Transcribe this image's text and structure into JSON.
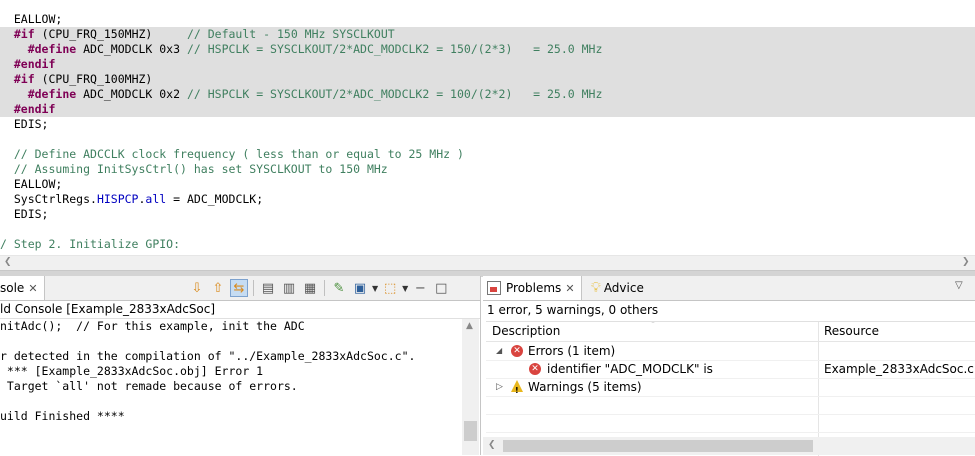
{
  "editor": {
    "lines": [
      {
        "pre": "  EALLOW;",
        "pp": "",
        "mid": "",
        "cmt": "",
        "shaded": false
      },
      {
        "pre": "  ",
        "pp": "#if",
        "mid": " (CPU_FRQ_150MHZ)     ",
        "cmt": "// Default - 150 MHz SYSCLKOUT",
        "shaded": true
      },
      {
        "pre": "    ",
        "pp": "#define",
        "mid": " ADC_MODCLK 0x3 ",
        "cmt": "// HSPCLK = SYSCLKOUT/2*ADC_MODCLK2 = 150/(2*3)   = 25.0 MHz",
        "shaded": true
      },
      {
        "pre": "  ",
        "pp": "#endif",
        "mid": "",
        "cmt": "",
        "shaded": true
      },
      {
        "pre": "  ",
        "pp": "#if",
        "mid": " (CPU_FRQ_100MHZ)",
        "cmt": "",
        "shaded": true
      },
      {
        "pre": "    ",
        "pp": "#define",
        "mid": " ADC_MODCLK 0x2 ",
        "cmt": "// HSPCLK = SYSCLKOUT/2*ADC_MODCLK2 = 100/(2*2)   = 25.0 MHz",
        "shaded": true
      },
      {
        "pre": "  ",
        "pp": "#endif",
        "mid": "",
        "cmt": "",
        "shaded": true
      },
      {
        "pre": "  EDIS;",
        "pp": "",
        "mid": "",
        "cmt": "",
        "shaded": false
      },
      {
        "pre": "",
        "pp": "",
        "mid": "",
        "cmt": "",
        "shaded": false
      },
      {
        "pre": "  ",
        "pp": "",
        "mid": "",
        "cmt": "// Define ADCCLK clock frequency ( less than or equal to 25 MHz )",
        "shaded": false
      },
      {
        "pre": "  ",
        "pp": "",
        "mid": "",
        "cmt": "// Assuming InitSysCtrl() has set SYSCLKOUT to 150 MHz",
        "shaded": false
      },
      {
        "pre": "  EALLOW;",
        "pp": "",
        "mid": "",
        "cmt": "",
        "shaded": false
      },
      {
        "pre": "  SysCtrlRegs.",
        "pp": "",
        "mid": "",
        "cmt": "",
        "fld": "HISPCP",
        "mid2": ".",
        "fld2": "all",
        "post": " = ADC_MODCLK;",
        "shaded": false
      },
      {
        "pre": "  EDIS;",
        "pp": "",
        "mid": "",
        "cmt": "",
        "shaded": false
      },
      {
        "pre": "",
        "pp": "",
        "mid": "",
        "cmt": "",
        "shaded": false
      },
      {
        "pre": "",
        "pp": "",
        "mid": "",
        "cmt": "/ Step 2. Initialize GPIO:",
        "shaded": false
      }
    ]
  },
  "console": {
    "tab_label": "sole",
    "header": "ld Console [Example_2833xAdcSoc]",
    "lines": [
      "nitAdc();  // For this example, init the ADC",
      "",
      "r detected in the compilation of \"../Example_2833xAdcSoc.c\".",
      " *** [Example_2833xAdcSoc.obj] Error 1",
      " Target `all' not remade because of errors.",
      "",
      "uild Finished ****"
    ]
  },
  "problems": {
    "tab_label": "Problems",
    "advice_label": "Advice",
    "summary": "1 error, 5 warnings, 0 others",
    "columns": {
      "description": "Description",
      "resource": "Resource"
    },
    "errors_group": "Errors (1 item)",
    "error_item": {
      "description": "identifier \"ADC_MODCLK\" is",
      "resource": "Example_2833xAdcSoc.c"
    },
    "warnings_group": "Warnings (5 items)"
  }
}
